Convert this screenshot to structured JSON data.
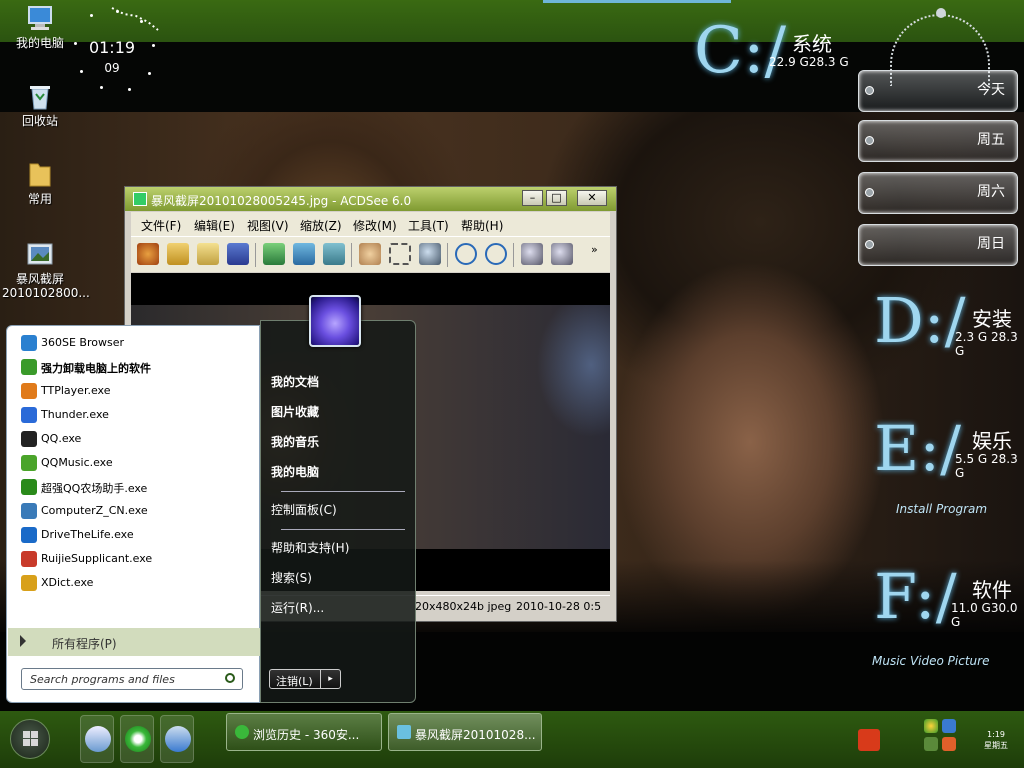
{
  "desktop": {
    "icons": [
      {
        "name": "my-computer-desktop-icon",
        "label": "我的电脑"
      },
      {
        "name": "recycle-bin-desktop-icon",
        "label": "回收站"
      },
      {
        "name": "folder-desktop-icon",
        "label": "常用"
      },
      {
        "name": "screenshot-file-desktop-icon",
        "label_line1": "暴风截屏",
        "label_line2": "2010102800..."
      }
    ],
    "clock": {
      "time": "01:19",
      "day": "09"
    }
  },
  "drives": {
    "c": {
      "letter": "C:/",
      "name": "系统",
      "usage": "22.9 G28.3 G"
    },
    "d": {
      "letter": "D:/",
      "name": "安装",
      "usage": "2.3 G 28.3 G"
    },
    "e": {
      "letter": "E:/",
      "name": "娱乐",
      "usage": "5.5 G 28.3 G",
      "caption": "Install Program"
    },
    "f": {
      "letter": "F:/",
      "name": "软件",
      "usage": "11.0 G30.0 G",
      "caption": "Music Video Picture"
    }
  },
  "weather_days": [
    "今天",
    "周五",
    "周六",
    "周日"
  ],
  "acdsee": {
    "title": "暴风截屏20101028005245.jpg - ACDSee 6.0",
    "buttons": {
      "minimize": "–",
      "maximize": "□",
      "close": "✕"
    },
    "menu": [
      "文件(F)",
      "编辑(E)",
      "视图(V)",
      "缩放(Z)",
      "修改(M)",
      "工具(T)",
      "帮助(H)"
    ],
    "more": "»",
    "status": {
      "size": "20x480x24b jpeg",
      "date": "2010-10-28 0:5"
    }
  },
  "start_menu": {
    "programs": [
      {
        "label": "360SE Browser",
        "color": "#2a80d0"
      },
      {
        "label": "强力卸载电脑上的软件",
        "color": "#3a9a2a",
        "bold": true
      },
      {
        "label": "TTPlayer.exe",
        "color": "#e07a1a"
      },
      {
        "label": "Thunder.exe",
        "color": "#2a6ad8"
      },
      {
        "label": "QQ.exe",
        "color": "#222222"
      },
      {
        "label": "QQMusic.exe",
        "color": "#4aa42a"
      },
      {
        "label": "超强QQ农场助手.exe",
        "color": "#2a8a1a"
      },
      {
        "label": "ComputerZ_CN.exe",
        "color": "#3a7ab8"
      },
      {
        "label": "DriveTheLife.exe",
        "color": "#1a6ac8"
      },
      {
        "label": "RuijieSupplicant.exe",
        "color": "#c83a2a"
      },
      {
        "label": "XDict.exe",
        "color": "#d8a01a"
      }
    ],
    "all_programs": "所有程序(P)",
    "search_placeholder": "Search programs and files",
    "right": {
      "documents": "我的文档",
      "pictures": "图片收藏",
      "music": "我的音乐",
      "computer": "我的电脑",
      "control_panel": "控制面板(C)",
      "help": "帮助和支持(H)",
      "search": "搜索(S)",
      "run": "运行(R)..."
    },
    "logoff": "注销(L)",
    "logoff_arrow": "▸"
  },
  "taskbar": {
    "buttons": [
      {
        "label": "浏览历史 - 360安..."
      },
      {
        "label": "暴风截屏20101028..."
      }
    ],
    "clock": {
      "time": "1:19",
      "weekday": "星期五"
    }
  }
}
